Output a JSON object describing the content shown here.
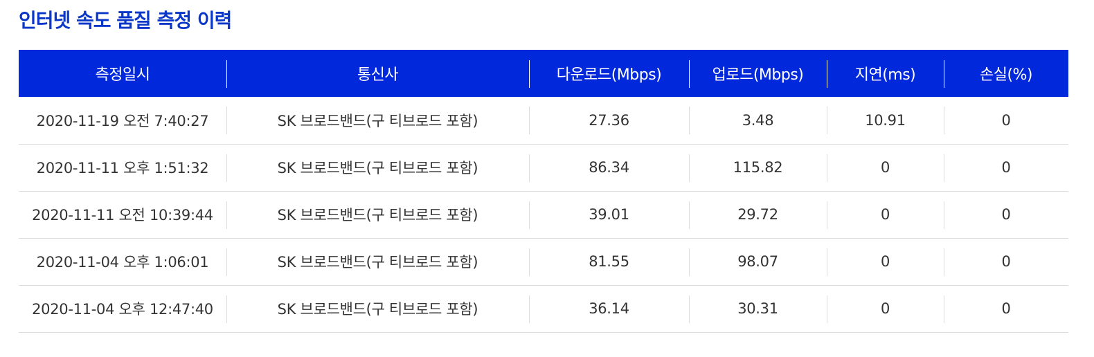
{
  "page": {
    "title": "인터넷 속도 품질 측정 이력"
  },
  "colors": {
    "title": "#0a37c8",
    "header_bg": "#0228dc",
    "header_text": "#ffffff",
    "row_border": "#dcdcdc"
  },
  "table": {
    "headers": [
      "측정일시",
      "통신사",
      "다운로드(Mbps)",
      "업로드(Mbps)",
      "지연(ms)",
      "손실(%)"
    ],
    "rows": [
      {
        "datetime": "2020-11-19 오전 7:40:27",
        "carrier": "SK 브로드밴드(구 티브로드 포함)",
        "download": "27.36",
        "upload": "3.48",
        "latency": "10.91",
        "loss": "0"
      },
      {
        "datetime": "2020-11-11 오후 1:51:32",
        "carrier": "SK 브로드밴드(구 티브로드 포함)",
        "download": "86.34",
        "upload": "115.82",
        "latency": "0",
        "loss": "0"
      },
      {
        "datetime": "2020-11-11 오전 10:39:44",
        "carrier": "SK 브로드밴드(구 티브로드 포함)",
        "download": "39.01",
        "upload": "29.72",
        "latency": "0",
        "loss": "0"
      },
      {
        "datetime": "2020-11-04 오후 1:06:01",
        "carrier": "SK 브로드밴드(구 티브로드 포함)",
        "download": "81.55",
        "upload": "98.07",
        "latency": "0",
        "loss": "0"
      },
      {
        "datetime": "2020-11-04 오후 12:47:40",
        "carrier": "SK 브로드밴드(구 티브로드 포함)",
        "download": "36.14",
        "upload": "30.31",
        "latency": "0",
        "loss": "0"
      }
    ]
  }
}
